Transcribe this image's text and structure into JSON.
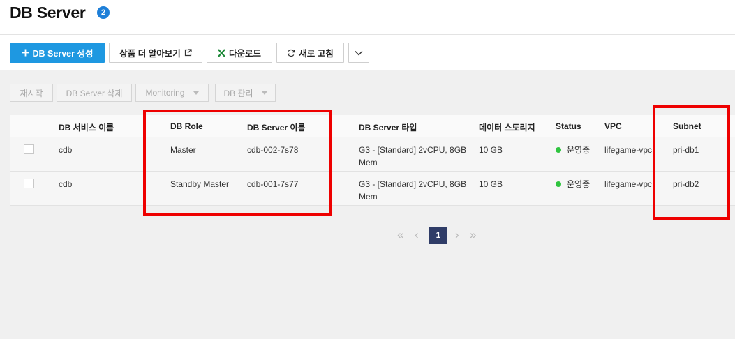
{
  "header": {
    "title": "DB Server",
    "count_badge": "2"
  },
  "toolbar": {
    "create_label": "DB Server 생성",
    "learn_more_label": "상품 더 알아보기",
    "download_label": "다운로드",
    "refresh_label": "새로 고침"
  },
  "actions": {
    "restart_label": "재시작",
    "delete_label": "DB Server 삭제",
    "monitoring_label": "Monitoring",
    "db_manage_label": "DB 관리"
  },
  "table": {
    "columns": [
      "DB 서비스 이름",
      "DB Role",
      "DB Server 이름",
      "DB Server 타입",
      "데이터 스토리지",
      "Status",
      "VPC",
      "Subnet"
    ],
    "rows": [
      {
        "service": "cdb",
        "role": "Master",
        "server_name": "cdb-002-7s78",
        "type_line1": "G3 - [Standard] 2vCPU, 8GB",
        "type_line2": "Mem",
        "storage": "10 GB",
        "status": "운영중",
        "vpc": "lifegame-vpc",
        "subnet": "pri-db1"
      },
      {
        "service": "cdb",
        "role": "Standby Master",
        "server_name": "cdb-001-7s77",
        "type_line1": "G3 - [Standard] 2vCPU, 8GB",
        "type_line2": "Mem",
        "storage": "10 GB",
        "status": "운영중",
        "vpc": "lifegame-vpc",
        "subnet": "pri-db2"
      }
    ]
  },
  "pagination": {
    "current_page": "1"
  },
  "colors": {
    "primary": "#1e98e1",
    "status_running": "#2fc43f",
    "highlight": "#ee0000",
    "page_active": "#2f3c67"
  },
  "icons": [
    "plus-icon",
    "external-link-icon",
    "excel-icon",
    "refresh-icon",
    "chevron-down-icon",
    "first-page-icon",
    "prev-page-icon",
    "next-page-icon",
    "last-page-icon"
  ]
}
